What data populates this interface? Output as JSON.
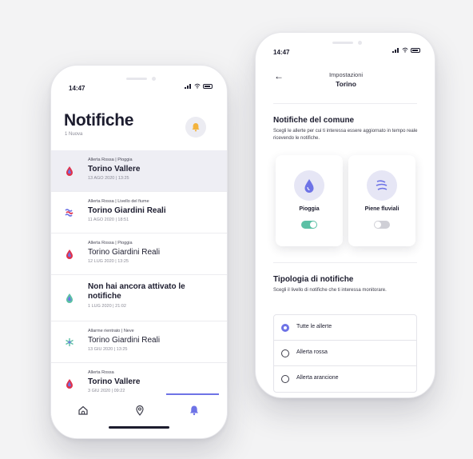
{
  "left_phone": {
    "status_time": "14:47",
    "title": "Notifiche",
    "subtitle": "1 Nuova",
    "notifications": [
      {
        "tag": "Allerta Rossa | Pioggia",
        "location": "Torino Vallere",
        "date": "13 AGO 2020 | 13:25"
      },
      {
        "tag": "Allerta Rossa | Livello del fiume",
        "location": "Torino Giardini Reali",
        "date": "11 AGO 2020 | 18:51"
      },
      {
        "tag": "Allerta Rossa | Pioggia",
        "location": "Torino Giardini Reali",
        "date": "12 LUG 2020 | 13:25"
      },
      {
        "tag": "",
        "location": "Non hai ancora attivato le notifiche",
        "date": "1 LUG 2020 | 21:02"
      },
      {
        "tag": "Allarme rientrato | Neve",
        "location": "Torino Giardini Reali",
        "date": "13 GIU 2020 | 13:25"
      },
      {
        "tag": "Allerta Rossa",
        "location": "Torino Vallere",
        "date": "3 GIU 2020 | 09:22"
      }
    ],
    "tabs": {
      "home": "home-icon",
      "map": "map-pin-icon",
      "notifications": "bell-icon"
    },
    "accent": "#6e73e6",
    "alert_red": "#e0324b"
  },
  "right_phone": {
    "status_time": "14:47",
    "header_title": "Impostazioni",
    "header_subtitle": "Torino",
    "section1_title": "Notifiche del comune",
    "section1_desc": "Scegli le allerte per cui ti interessa essere aggiornato in tempo reale ricevendo le notifiche.",
    "cards": [
      {
        "label": "Pioggia",
        "enabled": true
      },
      {
        "label": "Piene fluviali",
        "enabled": false
      }
    ],
    "section2_title": "Tipologia di notifiche",
    "section2_desc": "Scegli il livello di notifiche che ti interessa monitorare.",
    "options": [
      {
        "label": "Tutte le allerte",
        "selected": true
      },
      {
        "label": "Allerta rossa",
        "selected": false
      },
      {
        "label": "Allerta arancione",
        "selected": false
      }
    ],
    "toggle_on_color": "#5bc0a5"
  }
}
